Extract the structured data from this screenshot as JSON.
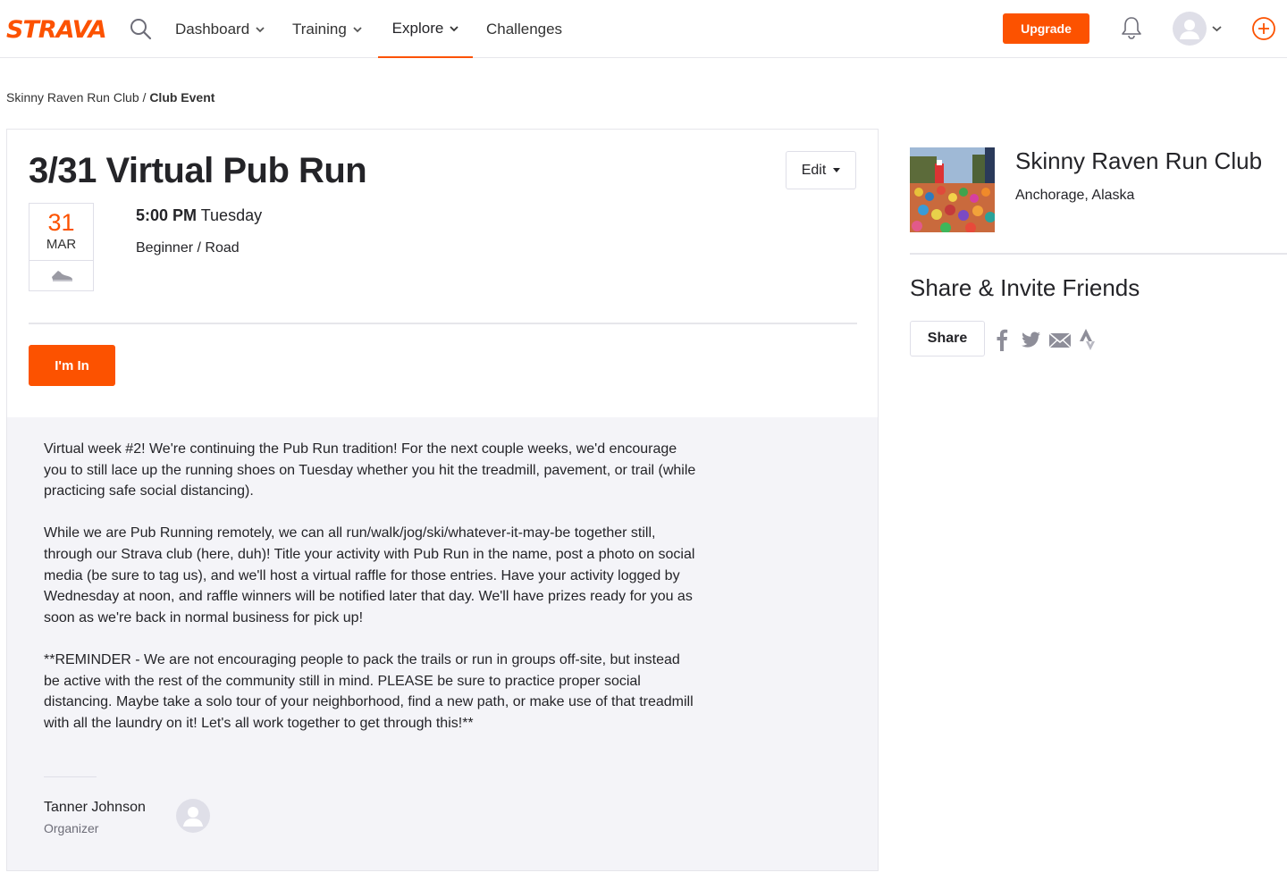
{
  "header": {
    "logo": "STRAVA",
    "nav": [
      {
        "label": "Dashboard"
      },
      {
        "label": "Training"
      },
      {
        "label": "Explore"
      },
      {
        "label": "Challenges"
      }
    ],
    "upgrade_label": "Upgrade",
    "accent_color": "#fc5200"
  },
  "breadcrumb": {
    "club": "Skinny Raven Run Club",
    "separator": " / ",
    "current": "Club Event"
  },
  "event": {
    "title": "3/31 Virtual Pub Run",
    "edit_label": "Edit",
    "date_day": "31",
    "date_month": "MAR",
    "time": "5:00 PM",
    "weekday": "Tuesday",
    "type": "Beginner / Road",
    "join_label": "I'm In",
    "description": [
      "Virtual week #2! We're continuing the Pub Run tradition! For the next couple weeks, we'd encourage you to still lace up the running shoes on Tuesday whether you hit the treadmill, pavement, or trail (while practicing safe social distancing).",
      "While we are Pub Running remotely, we can all run/walk/jog/ski/whatever-it-may-be together still, through our Strava club (here, duh)! Title your activity with Pub Run in the name, post a photo on social media (be sure to tag us), and we'll host a virtual raffle for those entries. Have your activity logged by Wednesday at noon, and raffle winners will be notified later that day. We'll have prizes ready for you as soon as we're back in normal business for pick up!",
      "**REMINDER - We are not encouraging people to pack the trails or run in groups off-site, but instead be active with the rest of the community still in mind. PLEASE be sure to practice proper social distancing. Maybe take a solo tour of your neighborhood, find a new path, or make use of that treadmill with all the laundry on it! Let's all work together to get through this!**"
    ],
    "organizer_name": "Tanner Johnson",
    "organizer_role": "Organizer"
  },
  "sidebar": {
    "club_name": "Skinny Raven Run Club",
    "club_location": "Anchorage, Alaska",
    "share_heading": "Share & Invite Friends",
    "share_label": "Share",
    "social_icons": [
      "facebook-icon",
      "twitter-icon",
      "email-icon",
      "strava-icon"
    ]
  }
}
